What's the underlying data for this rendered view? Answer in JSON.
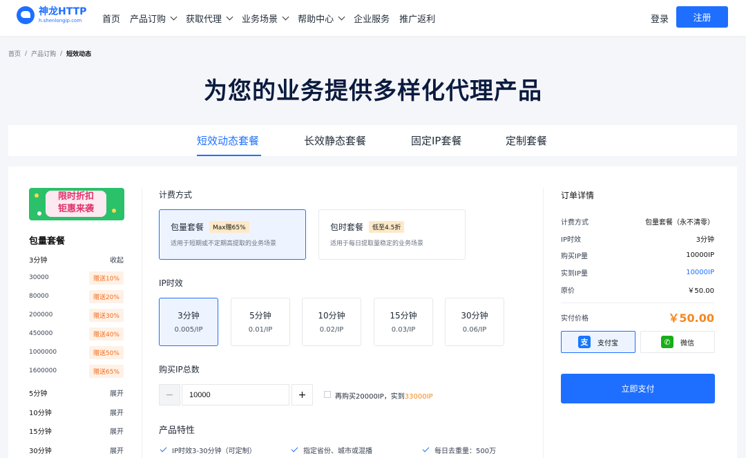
{
  "header": {
    "logo_name": "神龙HTTP",
    "logo_domain": "h.shenlongip.com",
    "nav": [
      {
        "label": "首页",
        "dropdown": false
      },
      {
        "label": "产品订购",
        "dropdown": true
      },
      {
        "label": "获取代理",
        "dropdown": true
      },
      {
        "label": "业务场景",
        "dropdown": true
      },
      {
        "label": "帮助中心",
        "dropdown": true
      },
      {
        "label": "企业服务",
        "dropdown": false
      },
      {
        "label": "推广返利",
        "dropdown": false
      }
    ],
    "login": "登录",
    "register": "注册"
  },
  "breadcrumb": [
    "首页",
    "产品订购",
    "短效动态"
  ],
  "page_title": "为您的业务提供多样化代理产品",
  "tabs": [
    {
      "label": "短效动态套餐",
      "active": true
    },
    {
      "label": "长效静态套餐",
      "active": false
    },
    {
      "label": "固定IP套餐",
      "active": false
    },
    {
      "label": "定制套餐",
      "active": false
    }
  ],
  "promo": {
    "line1": "限时折扣",
    "line2": "钜惠来袭"
  },
  "left_panel": {
    "title": "包量套餐",
    "group_3min": {
      "label": "3分钟",
      "action": "收起"
    },
    "bonuses": [
      {
        "amount": "30000",
        "bonus": "赠送10%"
      },
      {
        "amount": "80000",
        "bonus": "赠送20%"
      },
      {
        "amount": "200000",
        "bonus": "赠送30%"
      },
      {
        "amount": "450000",
        "bonus": "赠送40%"
      },
      {
        "amount": "1000000",
        "bonus": "赠送50%"
      },
      {
        "amount": "1600000",
        "bonus": "赠送65%"
      }
    ],
    "collapsed_groups": [
      {
        "label": "5分钟",
        "action": "展开"
      },
      {
        "label": "10分钟",
        "action": "展开"
      },
      {
        "label": "15分钟",
        "action": "展开"
      },
      {
        "label": "30分钟",
        "action": "展开"
      }
    ]
  },
  "billing": {
    "label": "计费方式",
    "options": [
      {
        "title": "包量套餐",
        "badge": "Max赠65%",
        "desc": "适用于短期或不定期高提取的业务场景",
        "selected": true
      },
      {
        "title": "包时套餐",
        "badge": "低至4.5折",
        "desc": "适用于每日提取量稳定的业务场景",
        "selected": false
      }
    ]
  },
  "ip_duration": {
    "label": "IP时效",
    "options": [
      {
        "duration": "3分钟",
        "price": "0.005/IP",
        "selected": true
      },
      {
        "duration": "5分钟",
        "price": "0.01/IP",
        "selected": false
      },
      {
        "duration": "10分钟",
        "price": "0.02/IP",
        "selected": false
      },
      {
        "duration": "15分钟",
        "price": "0.03/IP",
        "selected": false
      },
      {
        "duration": "30分钟",
        "price": "0.06/IP",
        "selected": false
      }
    ]
  },
  "quantity": {
    "label": "购买IP总数",
    "minus": "−",
    "value": "10000",
    "plus": "+",
    "upsell_text": "再购买20000IP，实到",
    "upsell_highlight": "33000IP"
  },
  "features": {
    "label": "产品特性",
    "items": [
      "IP时效3-30分钟（可定制）",
      "指定省份、城市或混播",
      "每日去重量：500万"
    ]
  },
  "order": {
    "title": "订单详情",
    "rows": [
      {
        "key": "计费方式",
        "value": "包量套餐（永不清零）"
      },
      {
        "key": "IP时效",
        "value": "3分钟"
      },
      {
        "key": "购买IP量",
        "value": "10000IP"
      },
      {
        "key": "实到IP量",
        "value": "10000IP"
      },
      {
        "key": "原价",
        "value": "￥50.00"
      }
    ],
    "pay_label": "实付价格",
    "pay_amount": "￥50.00",
    "methods": [
      {
        "label": "支付宝",
        "icon": "alipay-icon",
        "glyph": "支",
        "color": "#1677ff",
        "selected": true
      },
      {
        "label": "微信",
        "icon": "wechat-icon",
        "glyph": "✆",
        "color": "#1aad19",
        "selected": false
      }
    ],
    "submit": "立即支付"
  },
  "colors": {
    "accent": "#1e6fff",
    "orange": "#f5871f",
    "promo_green": "#2bc06a"
  }
}
